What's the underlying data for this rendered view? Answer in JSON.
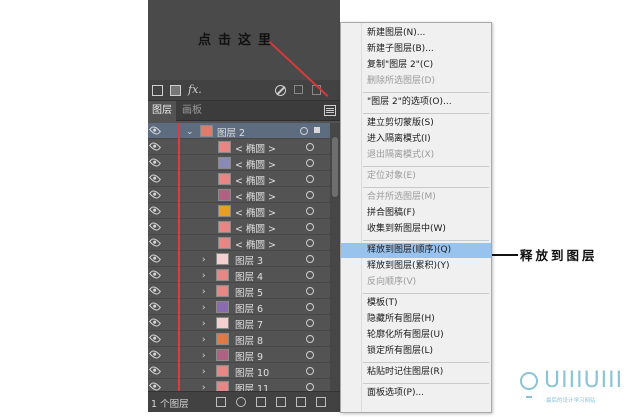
{
  "annotation_top": "点击这里",
  "annotation_right": "释放到图层",
  "panel": {
    "tabs": [
      {
        "label": "图层"
      },
      {
        "label": "画板"
      }
    ],
    "toolbar_fx": "fx.",
    "footer_count": "1 个图层",
    "rows": [
      {
        "name": "图层 2",
        "indent": 1,
        "expanded": true,
        "selected": true,
        "thumb_color": "#e07a6a"
      },
      {
        "name": "< 椭圆 >",
        "indent": 2,
        "thumb_color": "#e88585"
      },
      {
        "name": "< 椭圆 >",
        "indent": 2,
        "thumb_color": "#8a8ab8"
      },
      {
        "name": "< 椭圆 >",
        "indent": 2,
        "thumb_color": "#e88585"
      },
      {
        "name": "< 椭圆 >",
        "indent": 2,
        "thumb_color": "#b06080"
      },
      {
        "name": "< 椭圆 >",
        "indent": 2,
        "thumb_color": "#e8a020"
      },
      {
        "name": "< 椭圆 >",
        "indent": 2,
        "thumb_color": "#e88585"
      },
      {
        "name": "< 椭圆 >",
        "indent": 2,
        "thumb_color": "#e88585"
      },
      {
        "name": "图层 3",
        "indent": 1,
        "expanded": false,
        "thumb_color": "#f4d0d0"
      },
      {
        "name": "图层 4",
        "indent": 1,
        "expanded": false,
        "thumb_color": "#e88585"
      },
      {
        "name": "图层 5",
        "indent": 1,
        "expanded": false,
        "thumb_color": "#e88585"
      },
      {
        "name": "图层 6",
        "indent": 1,
        "expanded": false,
        "thumb_color": "#8a6ab0"
      },
      {
        "name": "图层 7",
        "indent": 1,
        "expanded": false,
        "thumb_color": "#f4d0d0"
      },
      {
        "name": "图层 8",
        "indent": 1,
        "expanded": false,
        "thumb_color": "#e07a40"
      },
      {
        "name": "图层 9",
        "indent": 1,
        "expanded": false,
        "thumb_color": "#b06080"
      },
      {
        "name": "图层 10",
        "indent": 1,
        "expanded": false,
        "thumb_color": "#e88585"
      },
      {
        "name": "图层 11",
        "indent": 1,
        "expanded": false,
        "thumb_color": "#e88585"
      }
    ]
  },
  "menu": {
    "items": [
      {
        "label": "新建图层(N)...",
        "disabled": false
      },
      {
        "label": "新建子图层(B)...",
        "disabled": false
      },
      {
        "label": "复制\"图层 2\"(C)",
        "disabled": false
      },
      {
        "label": "删除所选图层(D)",
        "disabled": true
      },
      {
        "sep": true
      },
      {
        "label": "\"图层 2\"的选项(O)...",
        "disabled": false
      },
      {
        "sep": true
      },
      {
        "label": "建立剪切蒙版(S)",
        "disabled": false
      },
      {
        "label": "进入隔离模式(I)",
        "disabled": false
      },
      {
        "label": "退出隔离模式(X)",
        "disabled": true
      },
      {
        "sep": true
      },
      {
        "label": "定位对象(E)",
        "disabled": true
      },
      {
        "sep": true
      },
      {
        "label": "合并所选图层(M)",
        "disabled": true
      },
      {
        "label": "拼合图稿(F)",
        "disabled": false
      },
      {
        "label": "收集到新图层中(W)",
        "disabled": false
      },
      {
        "sep": true
      },
      {
        "label": "释放到图层(顺序)(Q)",
        "disabled": false,
        "highlight": true
      },
      {
        "label": "释放到图层(累积)(Y)",
        "disabled": false
      },
      {
        "label": "反向顺序(V)",
        "disabled": true
      },
      {
        "sep": true
      },
      {
        "label": "模板(T)",
        "disabled": false
      },
      {
        "label": "隐藏所有图层(H)",
        "disabled": false
      },
      {
        "label": "轮廓化所有图层(U)",
        "disabled": false
      },
      {
        "label": "锁定所有图层(L)",
        "disabled": false
      },
      {
        "sep": true
      },
      {
        "label": "粘贴时记住图层(R)",
        "disabled": false
      },
      {
        "sep": true
      },
      {
        "label": "面板选项(P)...",
        "disabled": false
      }
    ]
  },
  "watermark": {
    "text": "UIIIUIII",
    "sub": "最后的设计学习网站"
  }
}
